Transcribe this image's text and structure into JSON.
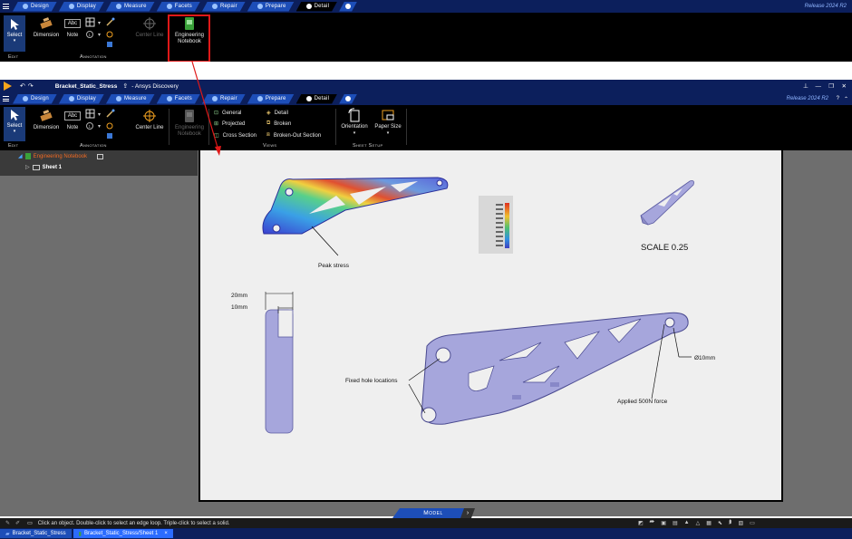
{
  "top_excerpt": {
    "tabs": [
      {
        "label": "Design",
        "active": false
      },
      {
        "label": "Display",
        "active": false
      },
      {
        "label": "Measure",
        "active": false
      },
      {
        "label": "Facets",
        "active": false
      },
      {
        "label": "Repair",
        "active": false
      },
      {
        "label": "Prepare",
        "active": false
      },
      {
        "label": "Detail",
        "active": true
      }
    ],
    "release": "Release 2024 R2",
    "select_label": "Select",
    "edit_group": "Edit",
    "dimension_label": "Dimension",
    "note_label": "Note",
    "note_icon_text": "Abc",
    "center_line_label": "Center Line",
    "annotation_group": "Annotation",
    "engineering_notebook_line1": "Engineering",
    "engineering_notebook_line2": "Notebook"
  },
  "window": {
    "title": "Bracket_Static_Stress",
    "app_name": "- Ansys Discovery",
    "release": "Release 2024 R2",
    "tabs": [
      {
        "label": "Design",
        "active": false
      },
      {
        "label": "Display",
        "active": false
      },
      {
        "label": "Measure",
        "active": false
      },
      {
        "label": "Facets",
        "active": false
      },
      {
        "label": "Repair",
        "active": false
      },
      {
        "label": "Prepare",
        "active": false
      },
      {
        "label": "Detail",
        "active": true
      }
    ],
    "ribbon": {
      "select_label": "Select",
      "edit_group": "Edit",
      "dimension_label": "Dimension",
      "note_label": "Note",
      "note_icon_text": "Abc",
      "center_line_label": "Center Line",
      "annotation_group": "Annotation",
      "engineering_notebook_line1": "Engineering",
      "engineering_notebook_line2": "Notebook",
      "views": {
        "general": "General",
        "projected": "Projected",
        "cross_section": "Cross Section",
        "detail": "Detail",
        "broken": "Broken",
        "broken_out_section": "Broken-Out Section",
        "group": "Views"
      },
      "orientation_label": "Orientation",
      "paper_size_label": "Paper Size",
      "sheet_setup_group": "Sheet Setup"
    },
    "tree": {
      "root": "Engineering Notebook",
      "child": "Sheet 1"
    },
    "drawing": {
      "peak_stress": "Peak stress",
      "scale": "SCALE 0.25",
      "dim_20mm": "20mm",
      "dim_10mm": "10mm",
      "fixed_holes": "Fixed hole locations",
      "applied_force": "Applied 500N force",
      "diameter": "Ø10mm"
    },
    "model_tab": "Model",
    "status_text": "Click an object. Double-click to select an edge loop. Triple-click to select a solid.",
    "doc_tabs": [
      {
        "label": "Bracket_Static_Stress",
        "active": false
      },
      {
        "label": "Bracket_Static_Stress/Sheet 1",
        "active": true
      }
    ]
  },
  "colors": {
    "title_blue": "#0c1f5c",
    "tab_blue": "#1d4eb8",
    "highlight_red": "#e01818",
    "notebook_green": "#3aa13a",
    "part_lavender": "#a6a6dc"
  }
}
